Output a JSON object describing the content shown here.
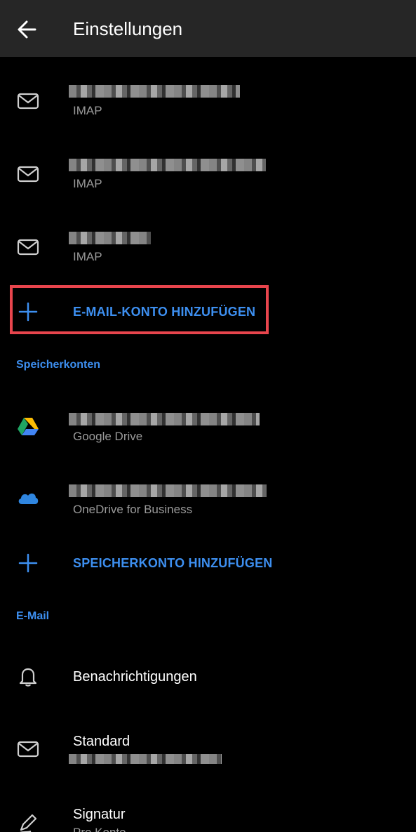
{
  "header": {
    "title": "Einstellungen"
  },
  "mail_accounts": [
    {
      "type": "IMAP"
    },
    {
      "type": "IMAP"
    },
    {
      "type": "IMAP"
    }
  ],
  "add_mail_account_label": "E-MAIL-KONTO HINZUFÜGEN",
  "storage_section": {
    "header": "Speicherkonten",
    "accounts": [
      {
        "type": "Google Drive"
      },
      {
        "type": "OneDrive for Business"
      }
    ],
    "add_label": "SPEICHERKONTO HINZUFÜGEN"
  },
  "email_section": {
    "header": "E-Mail",
    "items": [
      {
        "label": "Benachrichtigungen"
      },
      {
        "label": "Standard"
      },
      {
        "label": "Signatur",
        "sub": "Pro Konto"
      }
    ]
  },
  "colors": {
    "accent": "#3d8ff0",
    "highlight": "#e8454d",
    "appbar": "#262626"
  }
}
